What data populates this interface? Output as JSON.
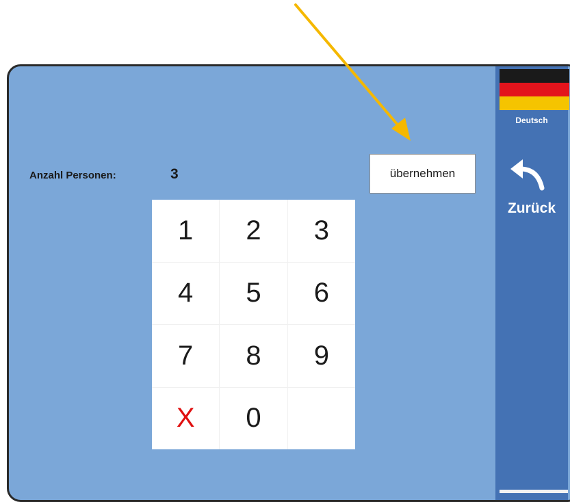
{
  "sidebar": {
    "language_label": "Deutsch",
    "back_label": "Zurück",
    "flag_icon": "german-flag-icon",
    "back_icon": "back-arrow-icon"
  },
  "form": {
    "count_label": "Anzahl Personen:",
    "count_value": "3",
    "apply_label": "übernehmen"
  },
  "keypad": {
    "keys": [
      "1",
      "2",
      "3",
      "4",
      "5",
      "6",
      "7",
      "8",
      "9",
      "X",
      "0",
      ""
    ]
  },
  "colors": {
    "screen_bg": "#7ba7d8",
    "sidebar_bg": "#4472b4",
    "clear_key": "#e01010",
    "annotation_arrow": "#f5b800"
  }
}
